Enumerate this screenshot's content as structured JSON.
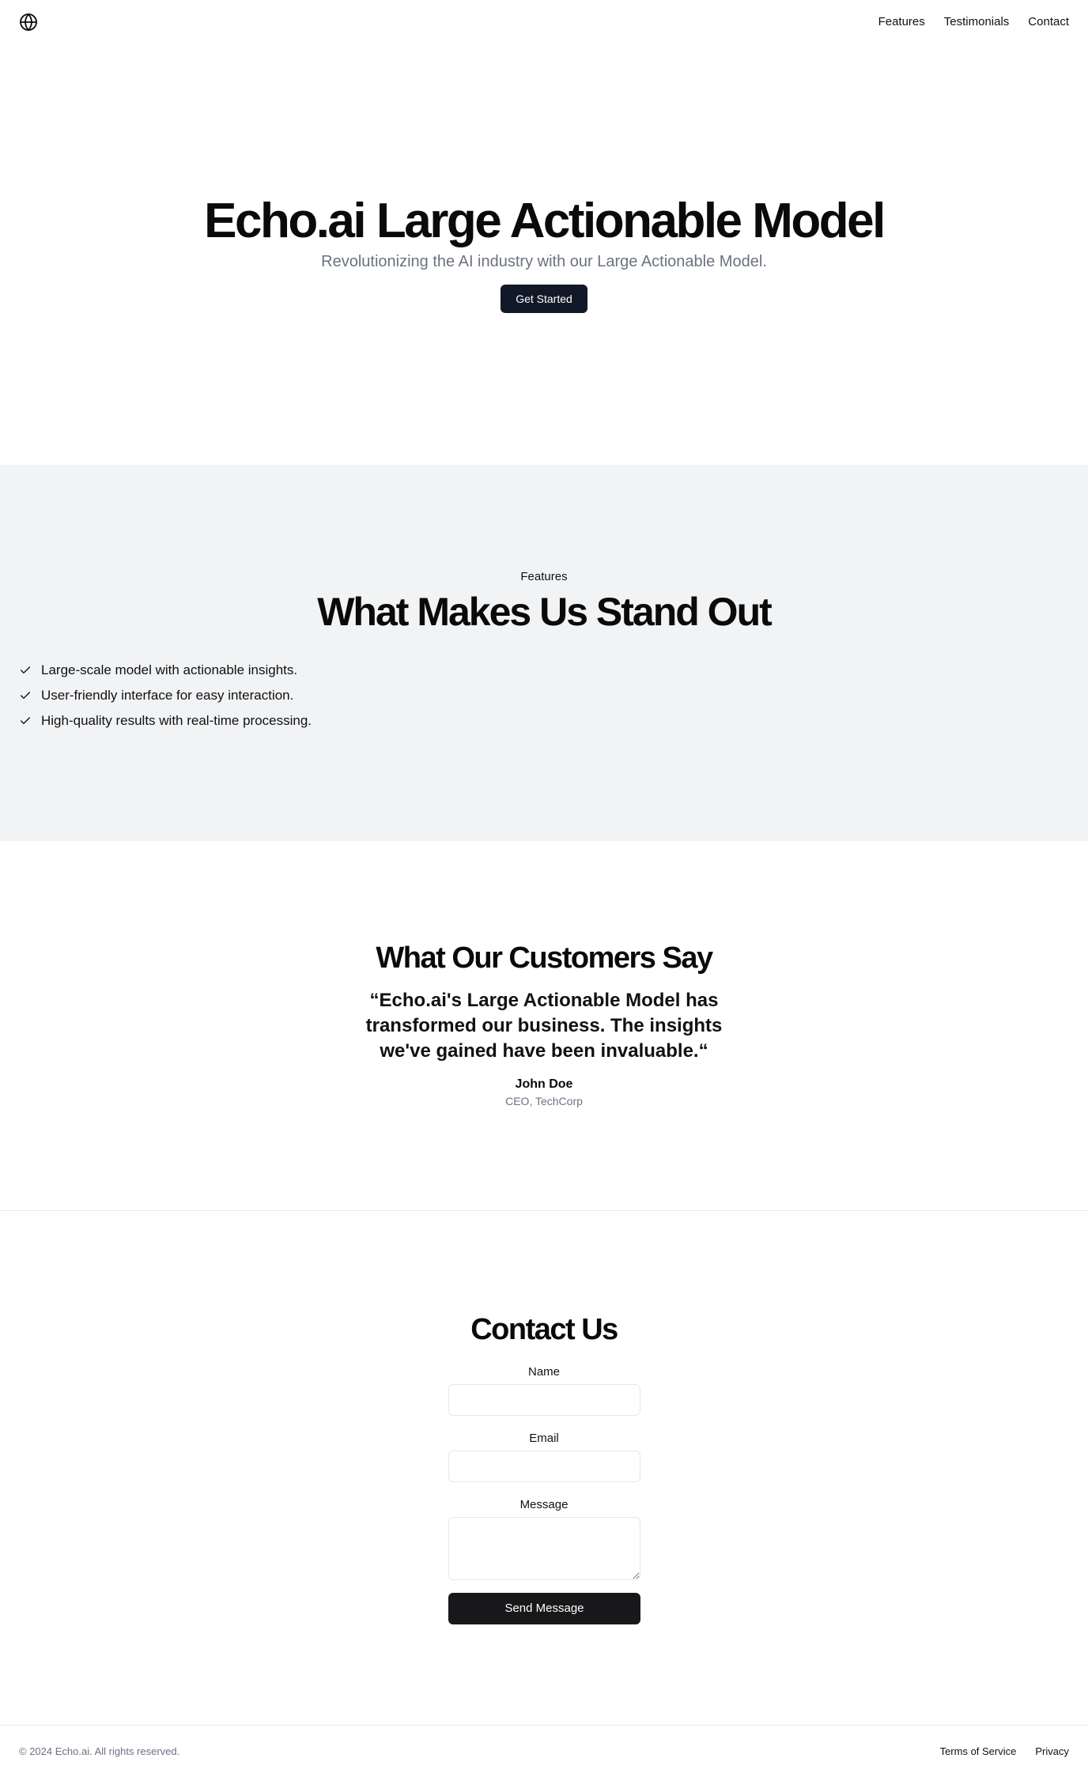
{
  "header": {
    "logo_icon": "globe-icon",
    "nav": [
      {
        "label": "Features"
      },
      {
        "label": "Testimonials"
      },
      {
        "label": "Contact"
      }
    ]
  },
  "hero": {
    "title": "Echo.ai Large Actionable Model",
    "subtitle": "Revolutionizing the AI industry with our Large Actionable Model.",
    "cta_label": "Get Started"
  },
  "features": {
    "eyebrow": "Features",
    "title": "What Makes Us Stand Out",
    "items": [
      {
        "icon": "check-icon",
        "text": "Large-scale model with actionable insights."
      },
      {
        "icon": "check-icon",
        "text": "User-friendly interface for easy interaction."
      },
      {
        "icon": "check-icon",
        "text": "High-quality results with real-time processing."
      }
    ]
  },
  "testimonials": {
    "title": "What Our Customers Say",
    "quote": "“Echo.ai's Large Actionable Model has transformed our business. The insights we've gained have been invaluable.“",
    "author": "John Doe",
    "role": "CEO, TechCorp"
  },
  "contact": {
    "title": "Contact Us",
    "name_label": "Name",
    "name_value": "",
    "email_label": "Email",
    "email_value": "",
    "message_label": "Message",
    "message_value": "",
    "submit_label": "Send Message"
  },
  "footer": {
    "copyright": "© 2024 Echo.ai. All rights reserved.",
    "links": [
      {
        "label": "Terms of Service"
      },
      {
        "label": "Privacy"
      }
    ]
  },
  "colors": {
    "primary_button": "#111827",
    "send_button": "#18181b",
    "features_bg": "#f2f3f5",
    "muted_text": "#6b7280"
  }
}
